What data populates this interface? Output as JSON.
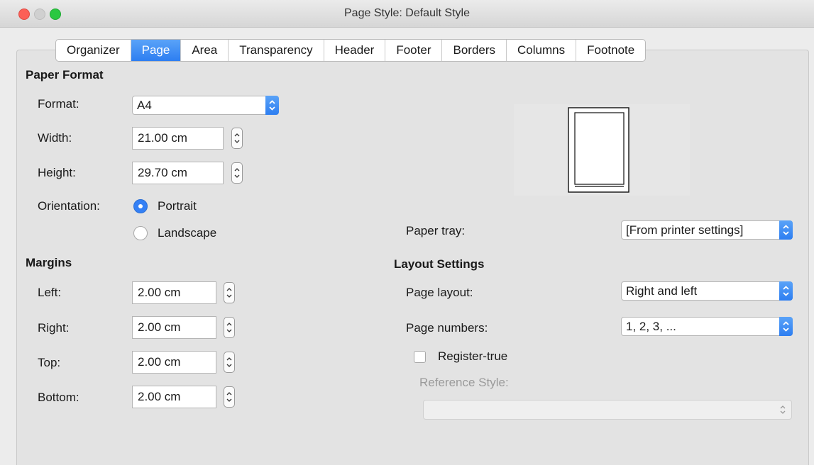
{
  "window": {
    "title": "Page Style: Default Style"
  },
  "tabs": [
    {
      "label": "Organizer"
    },
    {
      "label": "Page",
      "active": true
    },
    {
      "label": "Area"
    },
    {
      "label": "Transparency"
    },
    {
      "label": "Header"
    },
    {
      "label": "Footer"
    },
    {
      "label": "Borders"
    },
    {
      "label": "Columns"
    },
    {
      "label": "Footnote"
    }
  ],
  "paper_format": {
    "heading": "Paper Format",
    "format": {
      "label": "Format:",
      "value": "A4"
    },
    "width": {
      "label": "Width:",
      "value": "21.00 cm"
    },
    "height": {
      "label": "Height:",
      "value": "29.70 cm"
    },
    "orientation": {
      "label": "Orientation:",
      "options": [
        "Portrait",
        "Landscape"
      ],
      "selected": "Portrait"
    }
  },
  "margins": {
    "heading": "Margins",
    "left": {
      "label": "Left:",
      "value": "2.00 cm"
    },
    "right": {
      "label": "Right:",
      "value": "2.00 cm"
    },
    "top": {
      "label": "Top:",
      "value": "2.00 cm"
    },
    "bottom": {
      "label": "Bottom:",
      "value": "2.00 cm"
    }
  },
  "paper_tray": {
    "label": "Paper tray:",
    "value": "[From printer settings]"
  },
  "layout": {
    "heading": "Layout Settings",
    "page_layout": {
      "label": "Page layout:",
      "value": "Right and left"
    },
    "page_numbers": {
      "label": "Page numbers:",
      "value": "1, 2, 3, ..."
    },
    "register_true": {
      "label": "Register-true",
      "checked": false
    },
    "reference_style": {
      "label": "Reference Style:",
      "value": ""
    }
  },
  "colors": {
    "accent": "#2d7ef1",
    "close": "#fc5f57",
    "maximize": "#2ac840"
  },
  "icons": [
    "close-button",
    "minimize-button",
    "maximize-button",
    "chevron-updown-icon",
    "radio-selected",
    "radio-unselected",
    "checkbox",
    "page-preview"
  ]
}
